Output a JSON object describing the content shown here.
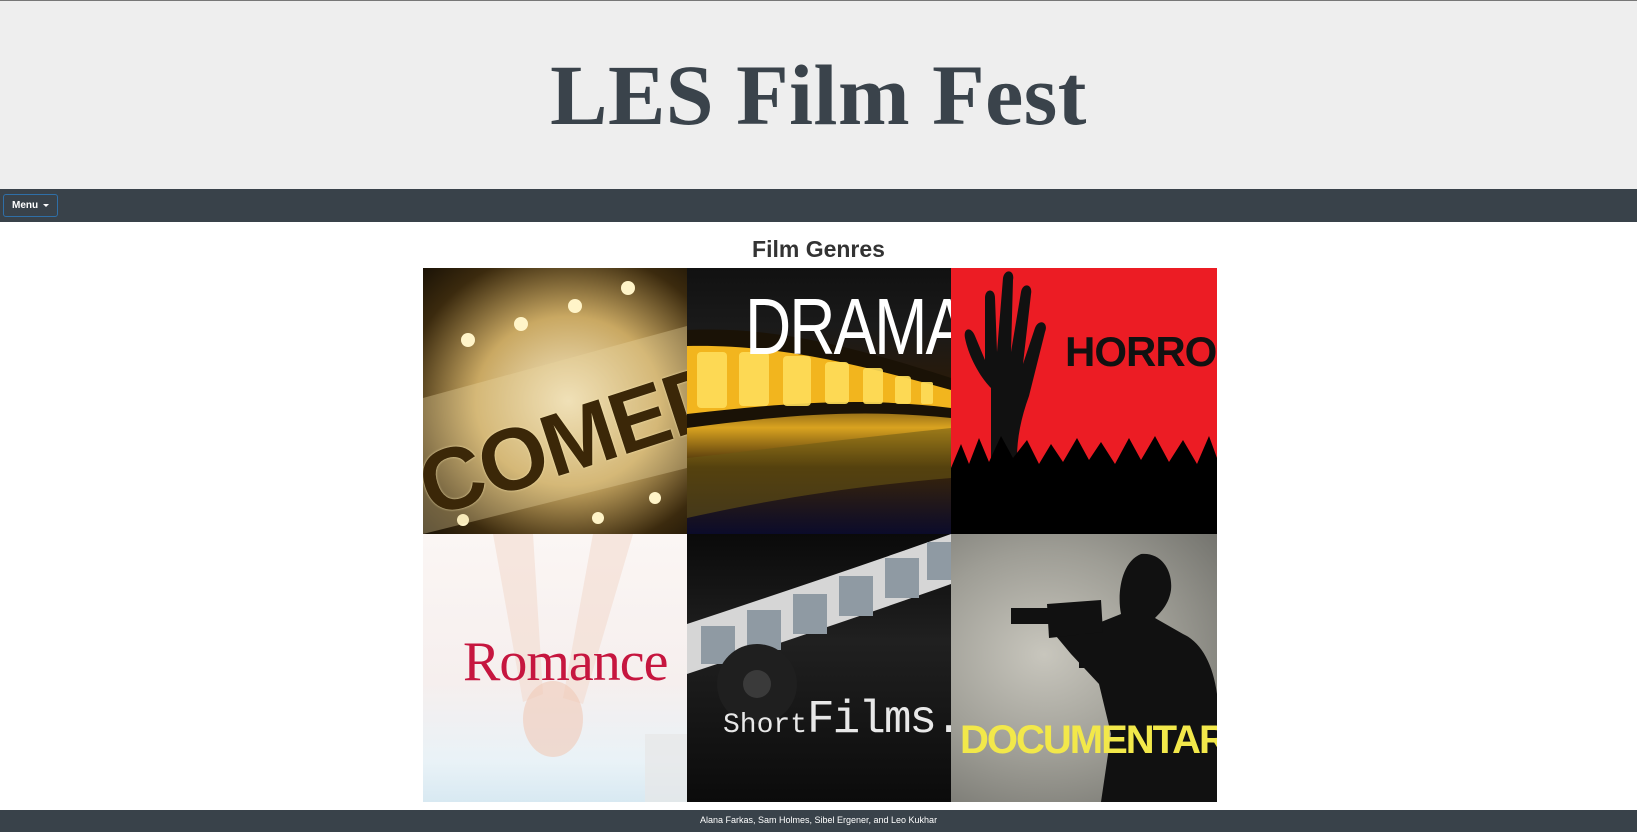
{
  "header": {
    "title": "LES Film Fest"
  },
  "navbar": {
    "menu_label": "Menu"
  },
  "main": {
    "section_title": "Film Genres",
    "genres": [
      {
        "label": "COMEDY"
      },
      {
        "label": "DRAMA"
      },
      {
        "label": "HORROR"
      },
      {
        "label": "Romance"
      },
      {
        "label_small": "Short",
        "label_large": "Films."
      },
      {
        "label": "DOCUMENTARY"
      }
    ]
  },
  "footer": {
    "credits": "Alana Farkas, Sam Holmes, Sibel Ergener, and Leo Kukhar"
  },
  "colors": {
    "header_bg": "#eeeeee",
    "title_color": "#3a434b",
    "navbar_bg": "#39424a",
    "horror_red": "#ec1c24",
    "romance_red": "#c6163f",
    "documentary_yellow": "#f2e84a"
  }
}
